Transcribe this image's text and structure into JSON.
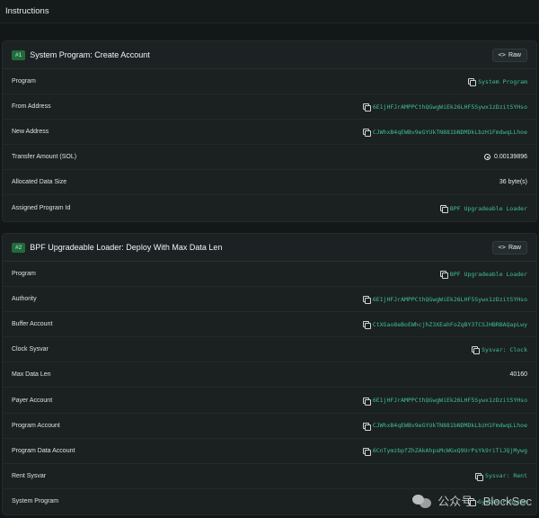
{
  "header": {
    "title": "Instructions"
  },
  "instructions": [
    {
      "badge": "#1",
      "title": "System Program: Create Account",
      "raw_label": "Raw",
      "rows": [
        {
          "label": "Program",
          "value": "System Program",
          "kind": "link"
        },
        {
          "label": "From Address",
          "value": "6E1jHFJrAMPPCthQGwgWiEk26LHF5Sywx1zDzitSYHso",
          "kind": "link"
        },
        {
          "label": "New Address",
          "value": "CJWhxB4qEWBv9eGYUkTN881bNDMDkLbzH1FmdwqLLhoe",
          "kind": "link"
        },
        {
          "label": "Transfer Amount (SOL)",
          "value": "0.00139896",
          "kind": "sol"
        },
        {
          "label": "Allocated Data Size",
          "value": "36 byte(s)",
          "kind": "plain"
        },
        {
          "label": "Assigned Program Id",
          "value": "BPF Upgradeable Loader",
          "kind": "link"
        }
      ]
    },
    {
      "badge": "#2",
      "title": "BPF Upgradeable Loader: Deploy With Max Data Len",
      "raw_label": "Raw",
      "rows": [
        {
          "label": "Program",
          "value": "BPF Upgradeable Loader",
          "kind": "link"
        },
        {
          "label": "Authority",
          "value": "6E1jHFJrAMPPCthQGwgWiEk26LHF5Sywx1zDzitSYHso",
          "kind": "link"
        },
        {
          "label": "Buffer Account",
          "value": "CtXGao8eBoEWhcjhZ3XEahFoZqBY3TCSJHBRBAQapLwy",
          "kind": "link"
        },
        {
          "label": "Clock Sysvar",
          "value": "Sysvar: Clock",
          "kind": "link"
        },
        {
          "label": "Max Data Len",
          "value": "40160",
          "kind": "plain"
        },
        {
          "label": "Payer Account",
          "value": "6E1jHFJrAMPPCthQGwgWiEk26LHF5Sywx1zDzitSYHso",
          "kind": "link"
        },
        {
          "label": "Program Account",
          "value": "CJWhxB4qEWBv9eGYUkTN881bNDMDkLbzH1FmdwqLLhoe",
          "kind": "link"
        },
        {
          "label": "Program Data Account",
          "value": "6CnTymzbpfZhZAkAhpsMcWGxQ9UrPsYk9riTiJQjMywg",
          "kind": "link"
        },
        {
          "label": "Rent Sysvar",
          "value": "Sysvar: Rent",
          "kind": "link"
        },
        {
          "label": "System Program",
          "value": "System Program",
          "kind": "link"
        }
      ]
    }
  ],
  "watermark": {
    "text": "公众号 · BlockSec"
  },
  "colors": {
    "accent": "#3fbf9a",
    "badge": "#1f6b3a",
    "background": "#131718",
    "card": "#1b2021"
  }
}
